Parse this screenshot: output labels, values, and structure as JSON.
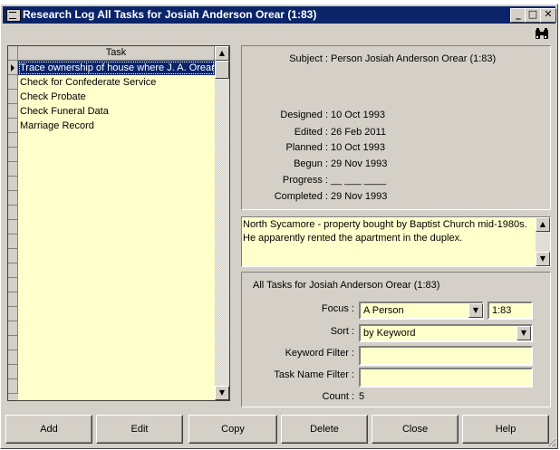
{
  "window": {
    "title": "Research Log All Tasks for Josiah Anderson  Orear (1:83)",
    "controls": {
      "minimize": "_",
      "maximize": "□",
      "close": "✕"
    }
  },
  "task_list": {
    "column_header": "Task",
    "rows": [
      "Trace ownership of house where J. A. Orear",
      "Check for Confederate Service",
      "Check Probate",
      "Check Funeral Data",
      "Marriage Record"
    ],
    "selected_index": 0
  },
  "details": {
    "subject_label": "Subject :",
    "subject_value": "Person Josiah Anderson  Orear (1:83)",
    "designed_label": "Designed :",
    "designed_value": "10 Oct 1993",
    "edited_label": "Edited :",
    "edited_value": "26 Feb 2011",
    "planned_label": "Planned :",
    "planned_value": "10 Oct 1993",
    "begun_label": "Begun :",
    "begun_value": "29 Nov 1993",
    "progress_label": "Progress :",
    "progress_value": "__ ___ ____",
    "completed_label": "Completed :",
    "completed_value": "29 Nov 1993"
  },
  "notes": {
    "text": "North Sycamore - property bought by Baptist Church mid-1980s. He apparently rented the apartment in the duplex."
  },
  "filter": {
    "heading": "All Tasks for Josiah Anderson  Orear (1:83)",
    "focus_label": "Focus :",
    "focus_value": "A Person",
    "focus_id": "1:83",
    "sort_label": "Sort :",
    "sort_value": "by Keyword",
    "keyword_filter_label": "Keyword Filter :",
    "keyword_filter_value": "",
    "task_name_filter_label": "Task Name Filter :",
    "task_name_filter_value": "",
    "count_label": "Count :",
    "count_value": "5"
  },
  "buttons": {
    "add": "Add",
    "edit": "Edit",
    "copy": "Copy",
    "delete": "Delete",
    "close": "Close",
    "help": "Help"
  },
  "icons": {
    "window": "form-window-icon",
    "find": "binoculars-icon",
    "resize": "resize-grip-icon"
  },
  "colors": {
    "title_bar": "#0a246a",
    "field_background": "#ffffcc",
    "window_face": "#d4d0c8"
  }
}
